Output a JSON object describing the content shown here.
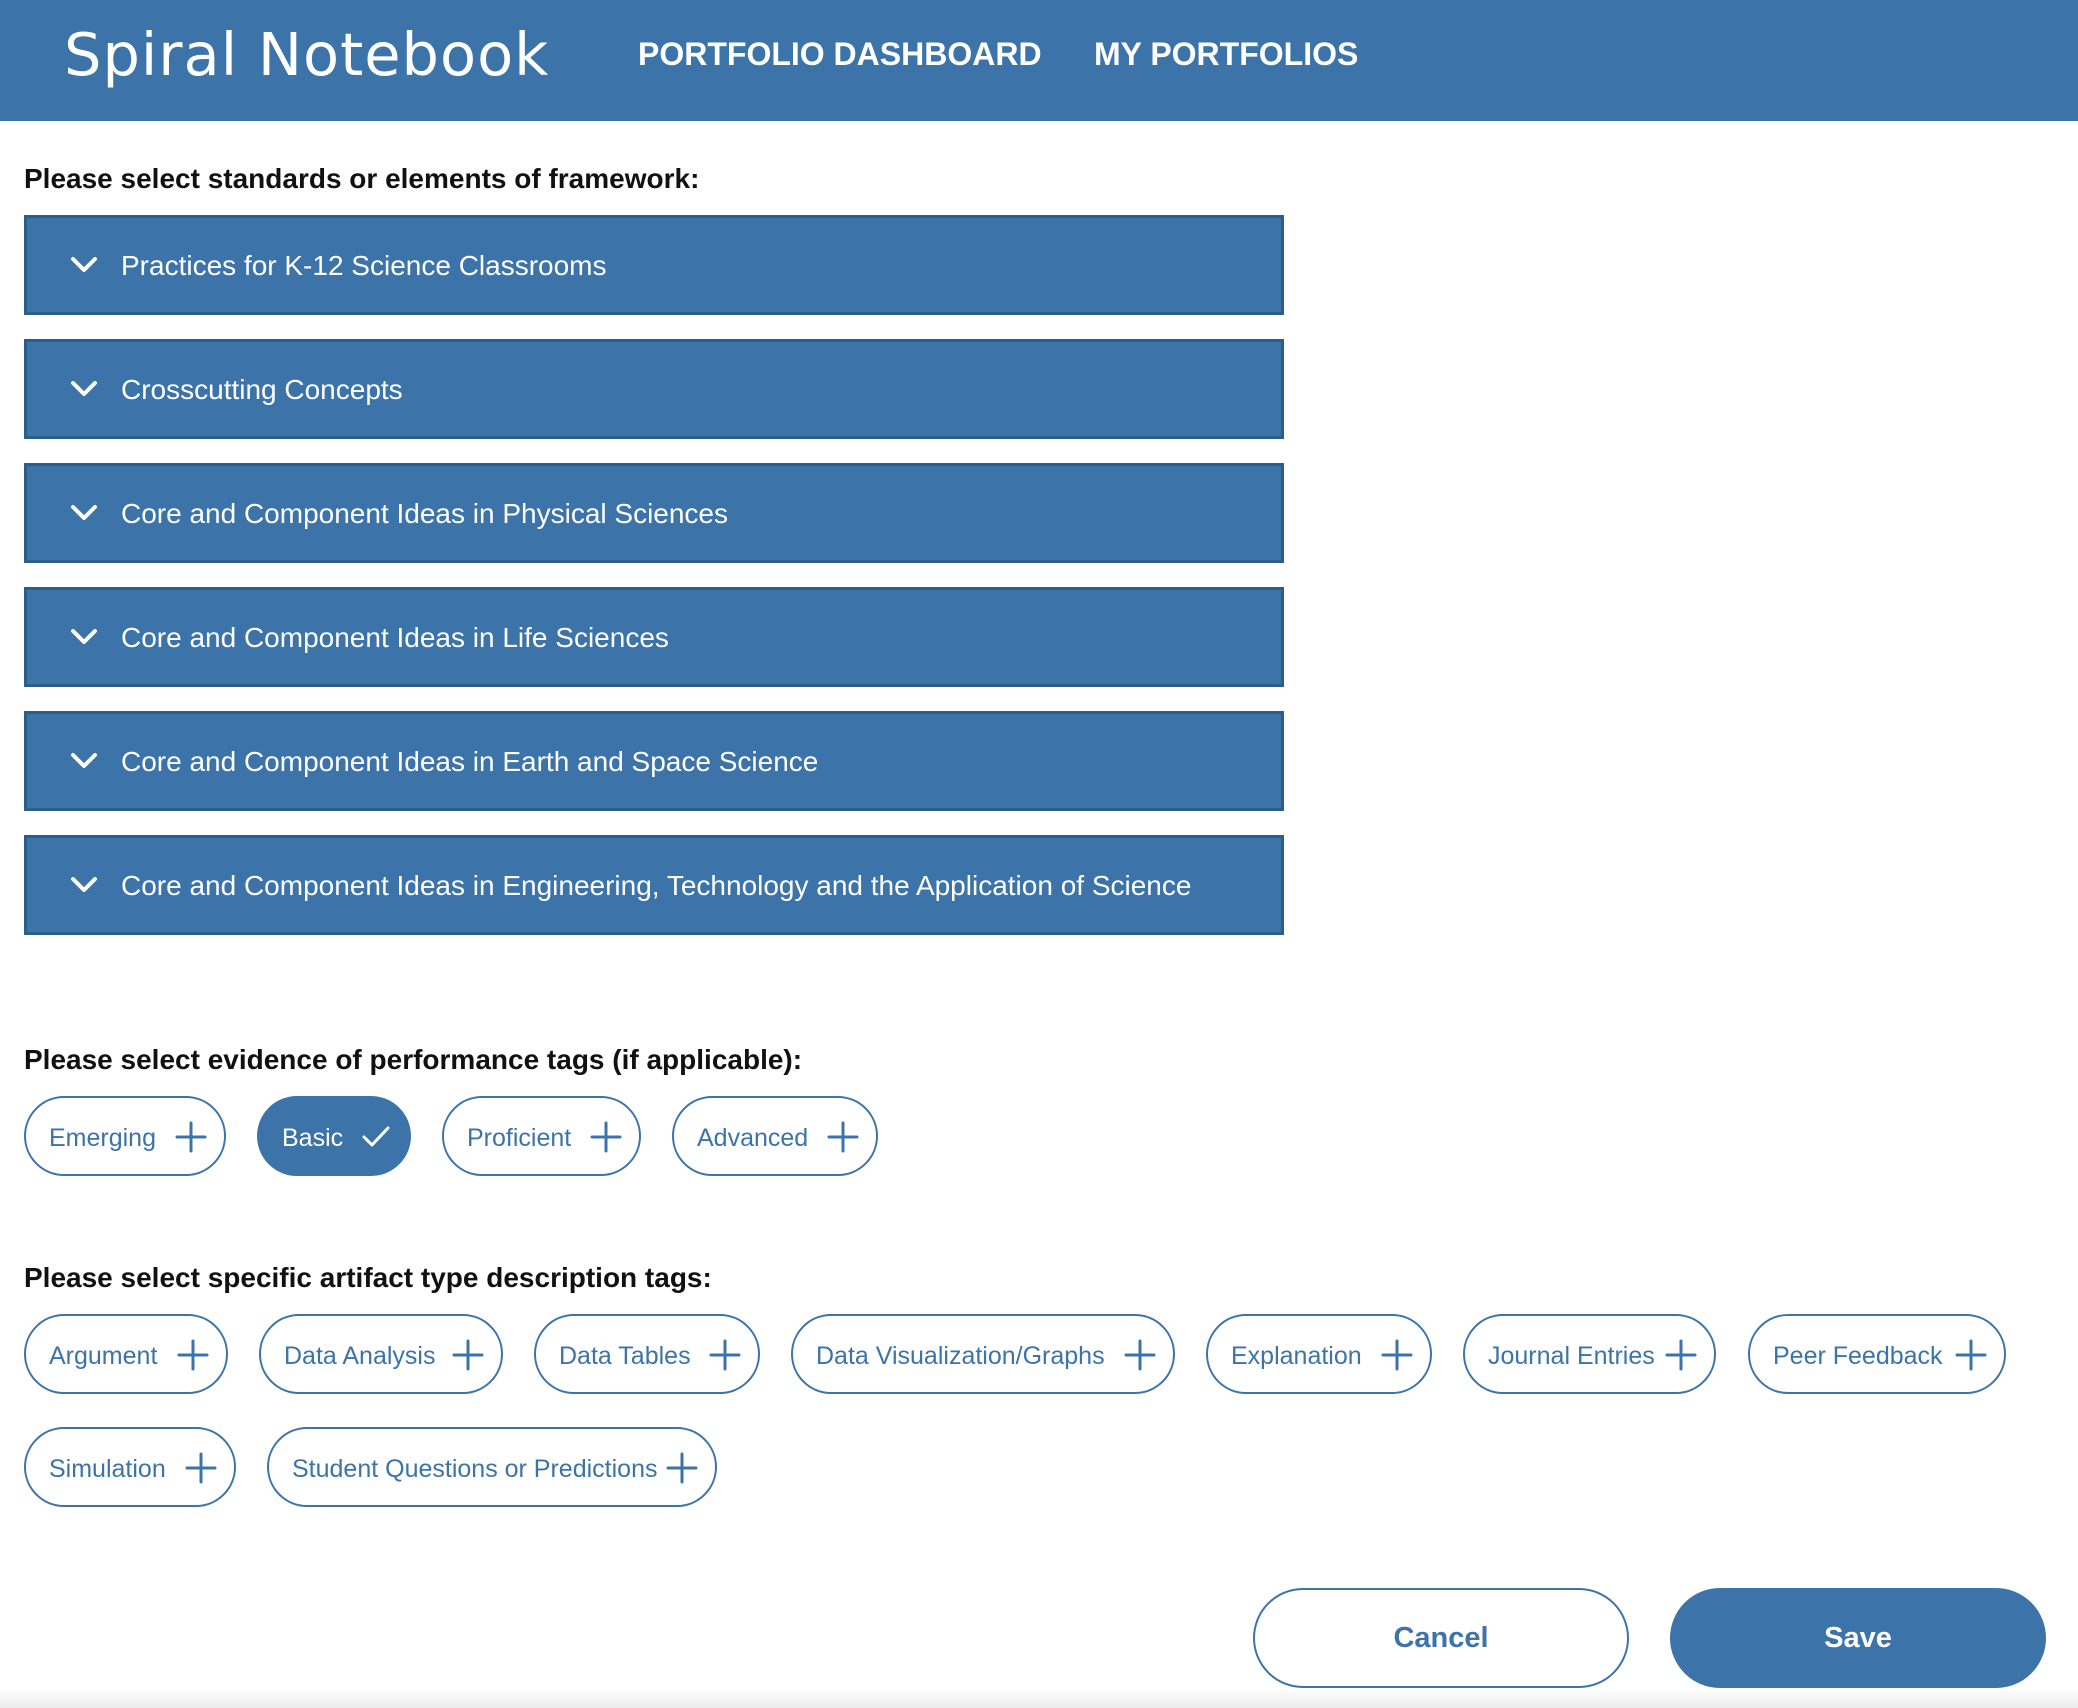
{
  "app": {
    "brand": "Spiral Notebook",
    "nav": [
      "PORTFOLIO DASHBOARD",
      "MY PORTFOLIOS"
    ]
  },
  "standards": {
    "heading": "Please select standards or elements of framework:",
    "items": [
      "Practices for K-12 Science Classrooms",
      "Crosscutting Concepts",
      "Core and Component Ideas in Physical Sciences",
      "Core and Component Ideas in Life Sciences",
      "Core and Component Ideas in Earth and Space Science",
      "Core and Component Ideas in Engineering, Technology and the Application of Science"
    ],
    "icon": "chevron-down-icon"
  },
  "performance": {
    "heading": "Please select evidence of performance tags (if applicable):",
    "tags": [
      {
        "label": "Emerging",
        "selected": false
      },
      {
        "label": "Basic",
        "selected": true
      },
      {
        "label": "Proficient",
        "selected": false
      },
      {
        "label": "Advanced",
        "selected": false
      }
    ]
  },
  "artifact": {
    "heading": "Please select specific artifact type description tags:",
    "tags": [
      {
        "label": "Argument",
        "selected": false
      },
      {
        "label": "Data Analysis",
        "selected": false
      },
      {
        "label": "Data Tables",
        "selected": false
      },
      {
        "label": "Data Visualization/Graphs",
        "selected": false
      },
      {
        "label": "Explanation",
        "selected": false
      },
      {
        "label": "Journal Entries",
        "selected": false
      },
      {
        "label": "Peer Feedback",
        "selected": false
      },
      {
        "label": "Simulation",
        "selected": false
      },
      {
        "label": "Student Questions or Predictions",
        "selected": false
      }
    ]
  },
  "actions": {
    "cancel": "Cancel",
    "save": "Save"
  },
  "colors": {
    "primary": "#3c73a9",
    "primary_border": "#2d5d8b",
    "text": "#111111",
    "background": "#ffffff"
  }
}
